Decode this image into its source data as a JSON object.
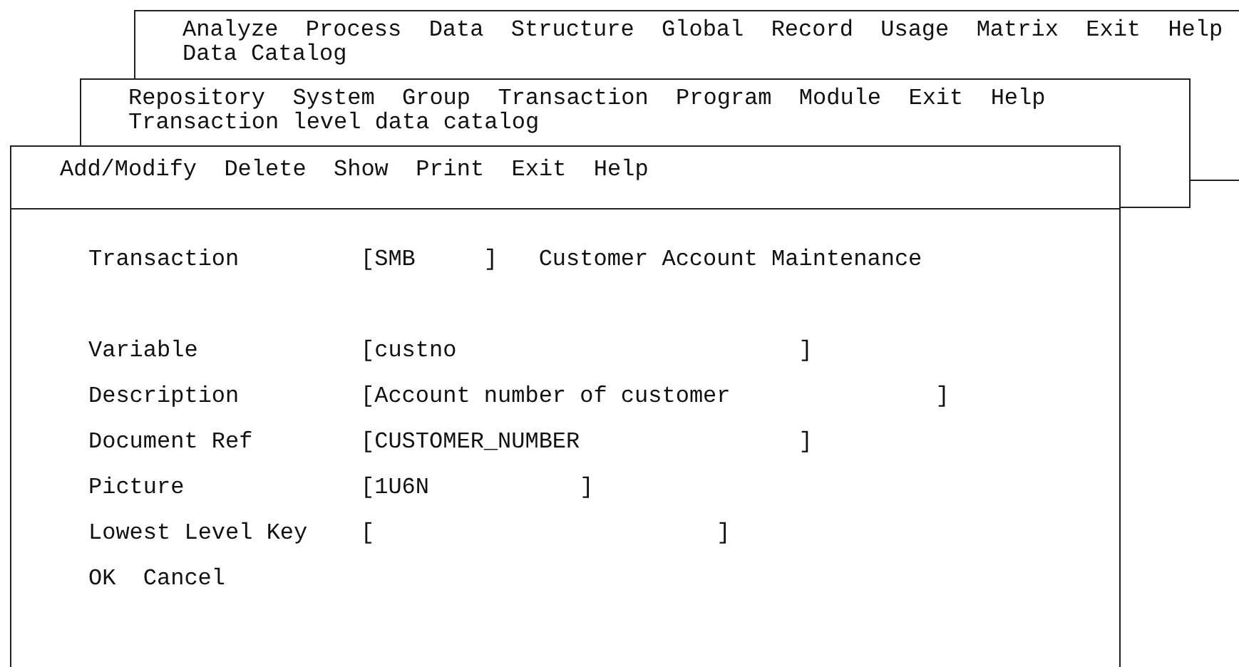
{
  "windows": [
    {
      "menu": [
        "Analyze",
        "Process",
        "Data",
        "Structure",
        "Global",
        "Record",
        "Usage",
        "Matrix",
        "Exit",
        "Help"
      ],
      "title": "Data Catalog"
    },
    {
      "menu": [
        "Repository",
        "System",
        "Group",
        "Transaction",
        "Program",
        "Module",
        "Exit",
        "Help"
      ],
      "title": "Transaction level data catalog"
    }
  ],
  "dialog": {
    "menu": [
      "Add/Modify",
      "Delete",
      "Show",
      "Print",
      "Exit",
      "Help"
    ],
    "transaction": {
      "label": "Transaction",
      "value": "[SMB     ]",
      "description": "Customer Account Maintenance"
    },
    "fields": [
      {
        "label": "Variable",
        "value": "[custno                         ]"
      },
      {
        "label": "Description",
        "value": "[Account number of customer               ]"
      },
      {
        "label": "Document Ref",
        "value": "[CUSTOMER_NUMBER                ]"
      },
      {
        "label": "Picture",
        "value": "[1U6N           ]"
      },
      {
        "label": "Lowest Level Key",
        "value": "[                         ]"
      }
    ],
    "buttons": [
      "OK",
      "Cancel"
    ]
  }
}
